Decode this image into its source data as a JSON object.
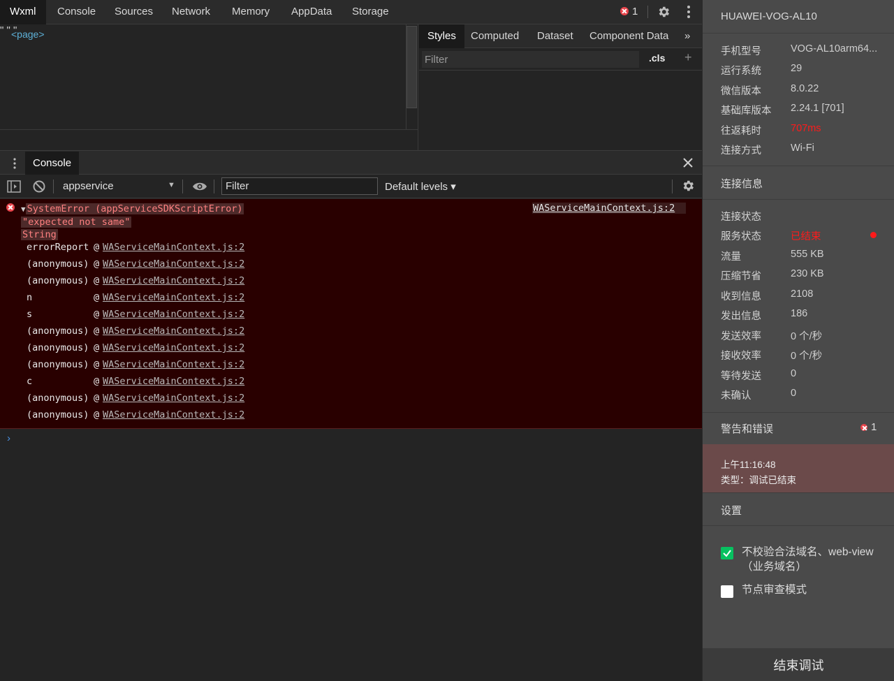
{
  "top_tabs": [
    "Wxml",
    "Console",
    "Sources",
    "Network",
    "Memory",
    "AppData",
    "Storage"
  ],
  "error_count": "1",
  "wxml": {
    "root_tag": "<page>",
    "quote": "\""
  },
  "styles": {
    "tabs": [
      "Styles",
      "Computed",
      "Dataset",
      "Component Data"
    ],
    "more": "»",
    "filter_placeholder": "Filter",
    "cls": ".cls",
    "plus": "+"
  },
  "drawer": {
    "tab": "Console",
    "close": "✕"
  },
  "console_toolbar": {
    "context": "appservice",
    "filter_placeholder": "Filter",
    "levels": "Default levels ▾"
  },
  "error": {
    "title": "SystemError (appServiceSDKScriptError)",
    "message": "\"expected not same\"",
    "type": "String",
    "source": "WAServiceMainContext.js:2",
    "stack": [
      {
        "fn": "errorReport",
        "link": "WAServiceMainContext.js:2"
      },
      {
        "fn": "(anonymous)",
        "link": "WAServiceMainContext.js:2"
      },
      {
        "fn": "(anonymous)",
        "link": "WAServiceMainContext.js:2"
      },
      {
        "fn": "n",
        "link": "WAServiceMainContext.js:2"
      },
      {
        "fn": "s",
        "link": "WAServiceMainContext.js:2"
      },
      {
        "fn": "(anonymous)",
        "link": "WAServiceMainContext.js:2"
      },
      {
        "fn": "(anonymous)",
        "link": "WAServiceMainContext.js:2"
      },
      {
        "fn": "(anonymous)",
        "link": "WAServiceMainContext.js:2"
      },
      {
        "fn": "c",
        "link": "WAServiceMainContext.js:2"
      },
      {
        "fn": "(anonymous)",
        "link": "WAServiceMainContext.js:2"
      },
      {
        "fn": "(anonymous)",
        "link": "WAServiceMainContext.js:2"
      }
    ],
    "at": "@"
  },
  "prompt": "›",
  "sidebar": {
    "device": "HUAWEI-VOG-AL10",
    "device_info": [
      {
        "key": "手机型号",
        "value": "VOG-AL10arm64..."
      },
      {
        "key": "运行系统",
        "value": "29"
      },
      {
        "key": "微信版本",
        "value": "8.0.22"
      },
      {
        "key": "基础库版本",
        "value": "2.24.1 [701]"
      },
      {
        "key": "往返耗时",
        "value": "707ms"
      },
      {
        "key": "连接方式",
        "value": "Wi-Fi"
      }
    ],
    "conn_title": "连接信息",
    "conn_info": [
      {
        "key": "连接状态",
        "value": ""
      },
      {
        "key": "服务状态",
        "value": "已结束"
      },
      {
        "key": "流量",
        "value": "555 KB"
      },
      {
        "key": "压缩节省",
        "value": "230 KB"
      },
      {
        "key": "收到信息",
        "value": "2108"
      },
      {
        "key": "发出信息",
        "value": "186"
      },
      {
        "key": "发送效率",
        "value": "0 个/秒"
      },
      {
        "key": "接收效率",
        "value": "0 个/秒"
      },
      {
        "key": "等待发送",
        "value": "0"
      },
      {
        "key": "未确认",
        "value": "0"
      }
    ],
    "warn_title": "警告和错误",
    "warn_count": "1",
    "log_time": "上午11:16:48",
    "log_type": "类型：调试已结束",
    "settings_title": "设置",
    "settings": [
      {
        "label": "不校验合法域名、web-view（业务域名）",
        "checked": true
      },
      {
        "label": "节点审查模式",
        "checked": false
      }
    ],
    "end_button": "结束调试"
  },
  "colors": {
    "error_bg": "#290000",
    "error_text": "#ff8080",
    "accent_red": "#ff1a1a",
    "check_green": "#07c160"
  }
}
